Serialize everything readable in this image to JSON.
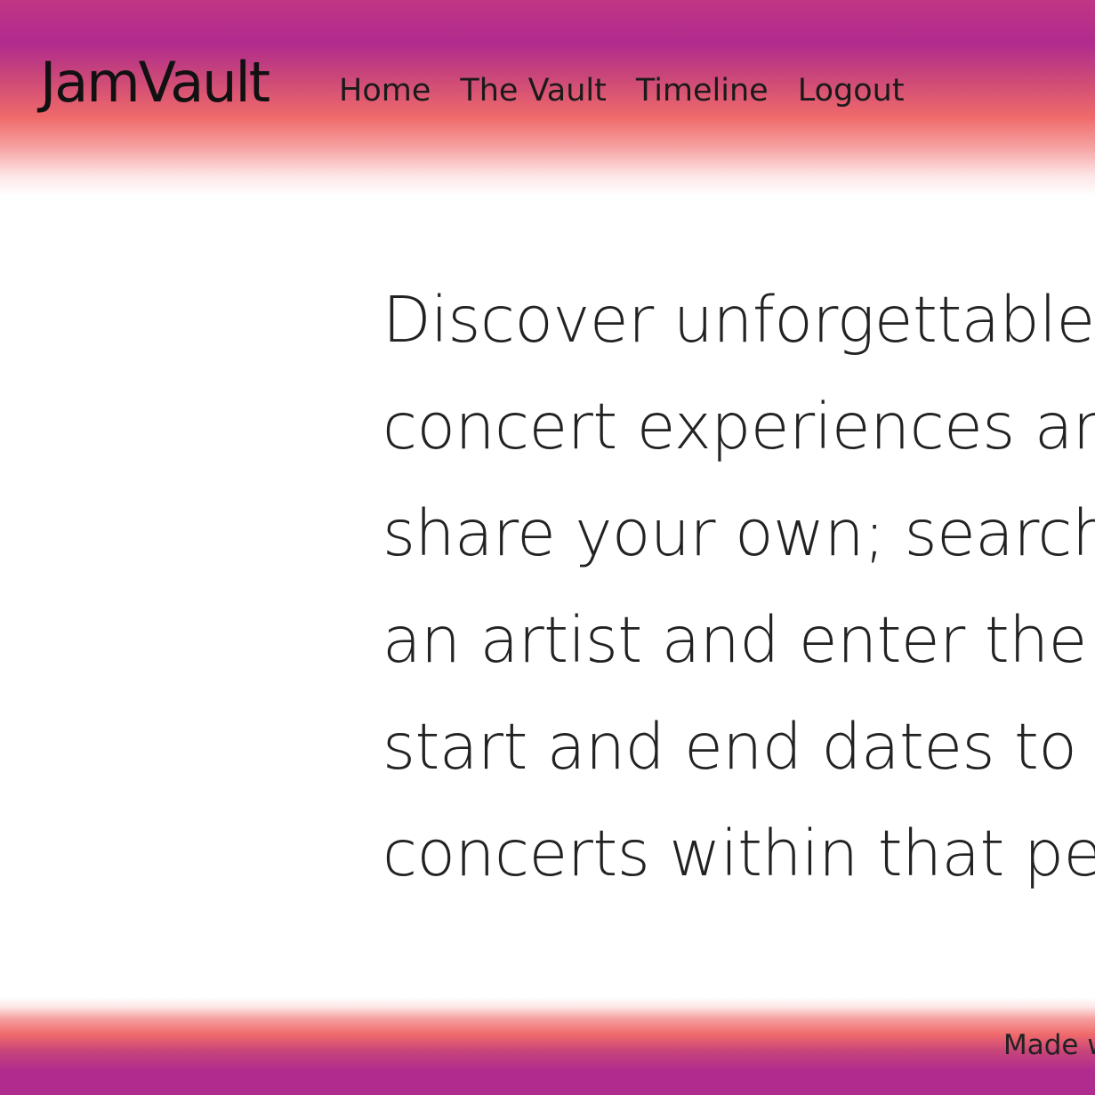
{
  "header": {
    "logo": "JamVault",
    "nav": [
      {
        "label": "Home"
      },
      {
        "label": "The Vault"
      },
      {
        "label": "Timeline"
      },
      {
        "label": "Logout"
      }
    ]
  },
  "main": {
    "intro_lines": [
      "Discover unforgettable",
      "concert experiences and",
      "share your own; search for",
      "an artist and enter the",
      "start and end dates to find",
      "concerts within that period."
    ]
  },
  "footer": {
    "text": "Made with"
  },
  "colors": {
    "gradient_purple": "#b02b8e",
    "gradient_coral": "#f06a6a",
    "text": "#222222"
  }
}
